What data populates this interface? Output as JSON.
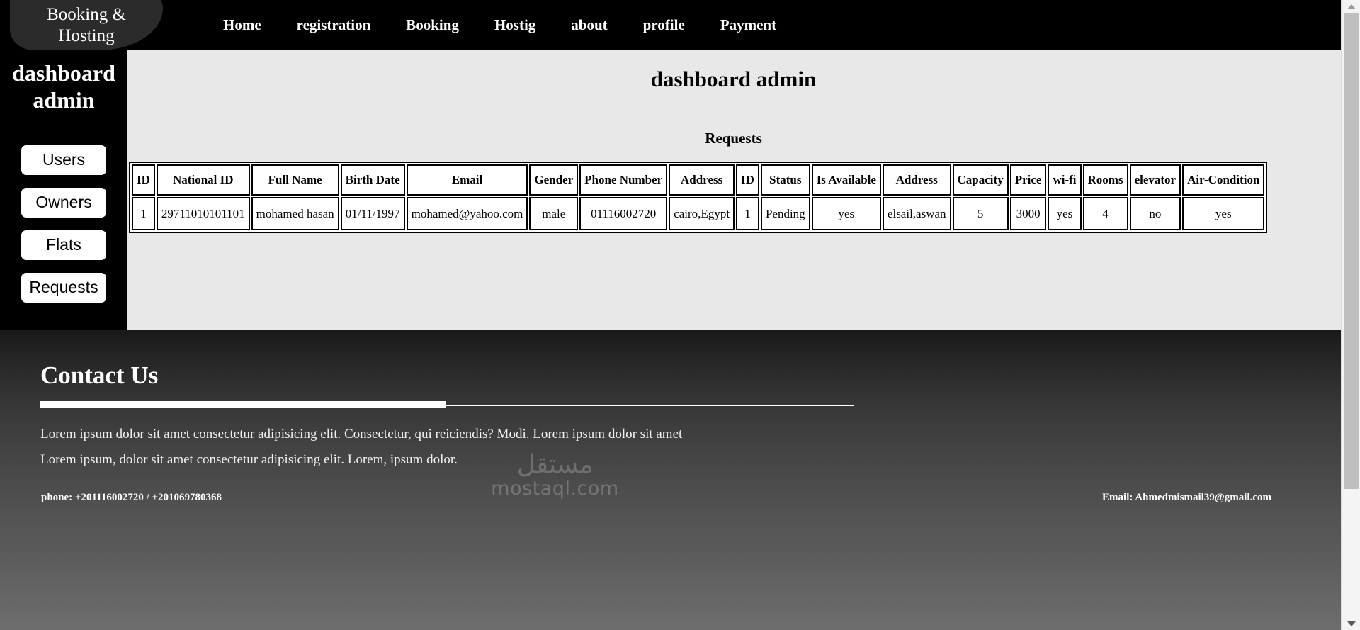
{
  "brand": {
    "line1": "Booking &",
    "line2": "Hosting"
  },
  "nav": {
    "items": [
      {
        "label": "Home"
      },
      {
        "label": "registration"
      },
      {
        "label": "Booking"
      },
      {
        "label": "Hostig"
      },
      {
        "label": "about"
      },
      {
        "label": "profile"
      },
      {
        "label": "Payment"
      }
    ]
  },
  "sidebar": {
    "title_line1": "dashboard",
    "title_line2": "admin",
    "buttons": [
      {
        "label": "Users"
      },
      {
        "label": "Owners"
      },
      {
        "label": "Flats"
      },
      {
        "label": "Requests"
      }
    ]
  },
  "main": {
    "page_title": "dashboard admin",
    "section_title": "Requests",
    "table": {
      "headers": [
        "ID",
        "National ID",
        "Full Name",
        "Birth Date",
        "Email",
        "Gender",
        "Phone Number",
        "Address",
        "ID",
        "Status",
        "Is Available",
        "Address",
        "Capacity",
        "Price",
        "wi-fi",
        "Rooms",
        "elevator",
        "Air-Condition"
      ],
      "rows": [
        [
          "1",
          "29711010101101",
          "mohamed hasan",
          "01/11/1997",
          "mohamed@yahoo.com",
          "male",
          "01116002720",
          "cairo,Egypt",
          "1",
          "Pending",
          "yes",
          "elsail,aswan",
          "5",
          "3000",
          "yes",
          "4",
          "no",
          "yes"
        ]
      ]
    }
  },
  "footer": {
    "heading": "Contact Us",
    "paragraph1": "Lorem ipsum dolor sit amet consectetur adipisicing elit. Consectetur, qui reiciendis? Modi. Lorem ipsum dolor sit amet",
    "paragraph2": "Lorem ipsum, dolor sit amet consectetur adipisicing elit. Lorem, ipsum dolor.",
    "phone": "phone: +201116002720 / +201069780368",
    "email": "Email: Ahmedmismail39@gmail.com",
    "watermark_ar": "مستقل",
    "watermark_en": "mostaql.com"
  },
  "colors": {
    "nav_bg": "#000000",
    "logo_bg": "#2b2b2b",
    "content_bg": "#e8e8e8",
    "footer_top": "#191919",
    "footer_bottom": "#6e6e6e",
    "button_bg": "#ffffff"
  }
}
